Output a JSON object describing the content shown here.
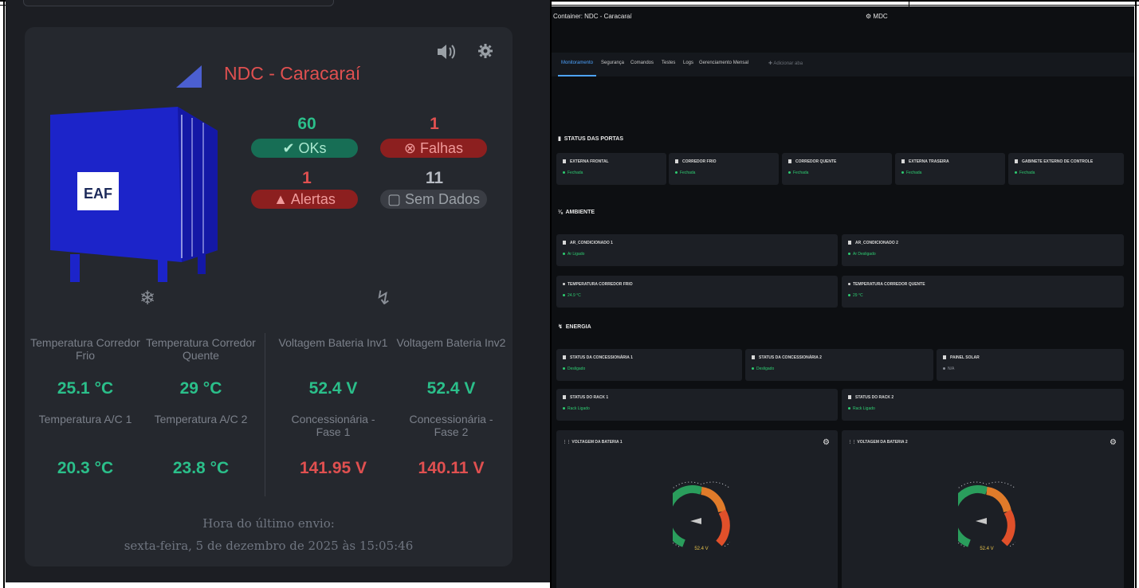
{
  "left": {
    "title": "NDC - Caracaraí",
    "icons": {
      "sound": "speaker-icon",
      "settings": "gear-icon"
    },
    "logo_text": "EAF",
    "stats": {
      "oks": {
        "value": "60",
        "label": "OKs"
      },
      "falhas": {
        "value": "1",
        "label": "Falhas"
      },
      "alertas": {
        "value": "1",
        "label": "Alertas"
      },
      "sem_dados": {
        "value": "11",
        "label": "Sem Dados"
      }
    },
    "metrics": {
      "temp_frio": {
        "label": "Temperatura Corredor Frio",
        "value": "25.1 °C"
      },
      "temp_quente": {
        "label": "Temperatura Corredor Quente",
        "value": "29 °C"
      },
      "volt_inv1": {
        "label": "Voltagem Bateria Inv1",
        "value": "52.4 V"
      },
      "volt_inv2": {
        "label": "Voltagem Bateria Inv2",
        "value": "52.4 V"
      },
      "temp_ac1": {
        "label": "Temperatura A/C 1",
        "value": "20.3 °C"
      },
      "temp_ac2": {
        "label": "Temperatura A/C 2",
        "value": "23.8 °C"
      },
      "conc_f1": {
        "label": "Concessionária - Fase 1",
        "value": "141.95 V"
      },
      "conc_f2": {
        "label": "Concessionária - Fase 2",
        "value": "140.11 V"
      }
    },
    "footer": {
      "label": "Hora do último envio:",
      "timestamp": "sexta-feira, 5 de dezembro de 2025 às 15:05:46"
    }
  },
  "right": {
    "header_left": "Container: NDC - Caracaraí",
    "header_center": "MDC",
    "tabs": [
      {
        "label": "Monitoramento"
      },
      {
        "label": "Segurança"
      },
      {
        "label": "Comandos"
      },
      {
        "label": "Testes"
      },
      {
        "label": "Logs"
      },
      {
        "label": "Gerenciamento Mensal"
      },
      {
        "label": "Adicionar aba"
      }
    ],
    "portas": {
      "title": "STATUS DAS PORTAS",
      "items": [
        {
          "label": "EXTERNA FRONTAL",
          "status": "Fechada"
        },
        {
          "label": "CORREDOR FRIO",
          "status": "Fechada"
        },
        {
          "label": "CORREDOR QUENTE",
          "status": "Fechada"
        },
        {
          "label": "EXTERNA TRASEIRA",
          "status": "Fechada"
        },
        {
          "label": "GABINETE EXTERNO DE CONTROLE",
          "status": "Fechada"
        }
      ]
    },
    "ambiente": {
      "title": "AMBIENTE",
      "items": [
        {
          "label": "AR_CONDICIONADO 1",
          "status": "Ar Ligado"
        },
        {
          "label": "AR_CONDICIONADO 2",
          "status": "Ar Desligado"
        },
        {
          "label": "TEMPERATURA CORREDOR FRIO",
          "status": "24.9 °C"
        },
        {
          "label": "TEMPERATURA CORREDOR QUENTE",
          "status": "29 °C"
        }
      ]
    },
    "energia": {
      "title": "ENERGIA",
      "items": [
        {
          "label": "STATUS DA CONCESSIONÁRIA 1",
          "status": "Desligado"
        },
        {
          "label": "STATUS DA CONCESSIONÁRIA 2",
          "status": "Desligado"
        },
        {
          "label": "PAINEL SOLAR",
          "status": "N/A"
        },
        {
          "label": "STATUS DO RACK 1",
          "status": "Rack Ligado"
        },
        {
          "label": "STATUS DO RACK 2",
          "status": "Rack Ligado"
        }
      ]
    },
    "gauges": [
      {
        "label": "VOLTAGEM DA BATERIA 1",
        "value": "52.4 V"
      },
      {
        "label": "VOLTAGEM DA BATERIA 2",
        "value": "52.4 V"
      }
    ]
  },
  "colors": {
    "ok": "#2bbf8a",
    "fail": "#e05050",
    "alert_bg": "#8c1f1f",
    "accent_blue": "#4da3ff",
    "status_green": "#2ecc71"
  }
}
